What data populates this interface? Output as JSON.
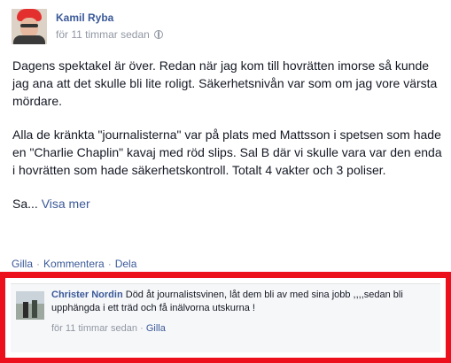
{
  "post": {
    "author": "Kamil Ryba",
    "timestamp": "för 11 timmar sedan",
    "privacy_icon": "globe-icon",
    "paragraphs": [
      "Dagens spektakel är över. Redan när jag kom till hovrätten imorse så kunde jag ana att det skulle bli lite roligt. Säkerhetsnivån var som om jag vore värsta mördare.",
      "Alla de kränkta \"journalisterna\" var på plats med Mattsson i spetsen som hade en \"Charlie Chaplin\" kavaj med röd slips. Sal B där vi skulle vara var den enda i hovrätten som hade säkerhetskontroll. Totalt 4 vakter och 3 poliser."
    ],
    "truncated_text": "Sa...",
    "see_more": "Visa mer"
  },
  "actions": {
    "like": "Gilla",
    "comment": "Kommentera",
    "share": "Dela",
    "separator": "·"
  },
  "comment": {
    "author": "Christer Nordin",
    "text": "Död åt journalistsvinen, låt dem bli av med sina jobb ,,,,sedan bli upphängda i ett träd och få inälvorna utskurna !",
    "timestamp": "för 11 timmar sedan",
    "like": "Gilla",
    "separator": "·"
  },
  "colors": {
    "highlight_border": "#ec0f1c",
    "link": "#3b5998",
    "muted": "#9197a3"
  }
}
